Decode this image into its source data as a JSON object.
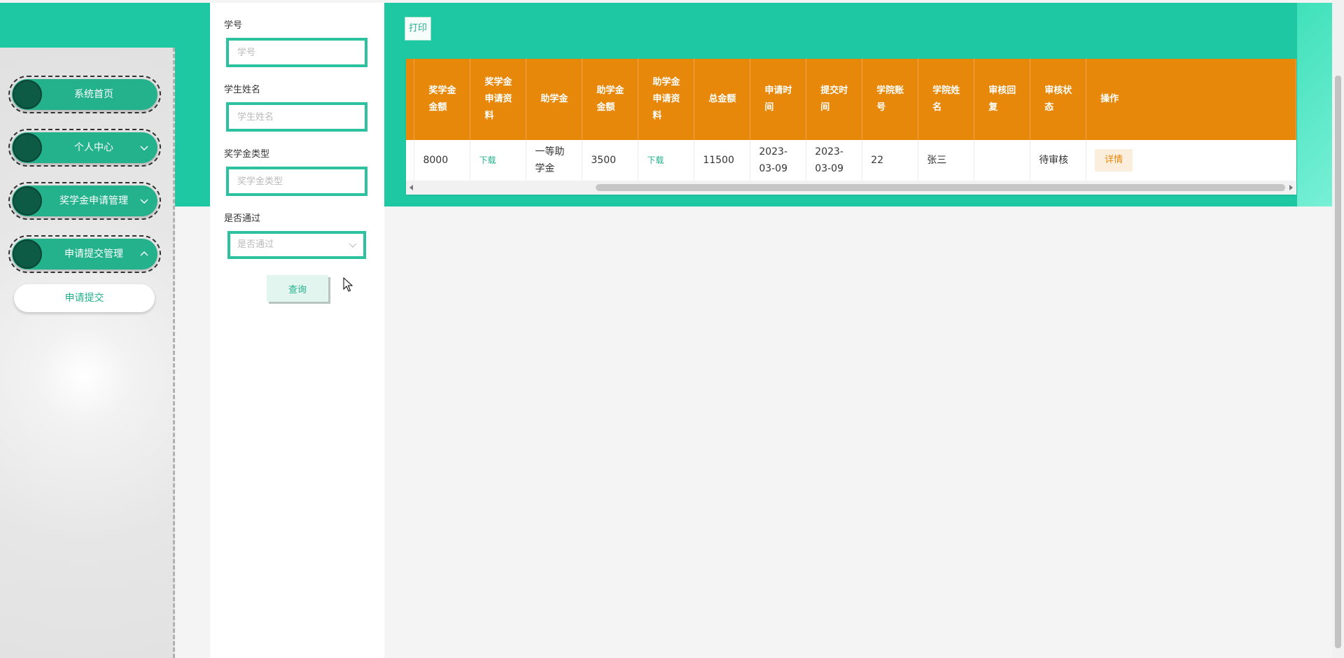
{
  "sidebar": {
    "items": [
      {
        "label": "系统首页",
        "chevron": "none"
      },
      {
        "label": "个人中心",
        "chevron": "down"
      },
      {
        "label": "奖学金申请管理",
        "chevron": "down"
      },
      {
        "label": "申请提交管理",
        "chevron": "up"
      }
    ],
    "submenu": {
      "label": "申请提交"
    }
  },
  "search": {
    "student_no": {
      "label": "学号",
      "placeholder": "学号",
      "value": ""
    },
    "student_name": {
      "label": "学生姓名",
      "placeholder": "学生姓名",
      "value": ""
    },
    "scholarship_type": {
      "label": "奖学金类型",
      "placeholder": "奖学金类型",
      "value": ""
    },
    "passed": {
      "label": "是否通过",
      "placeholder": "是否通过"
    },
    "query_label": "查询"
  },
  "toolbar": {
    "print_label": "打印"
  },
  "table": {
    "headers": [
      "奖学金金额",
      "奖学金申请资料",
      "助学金",
      "助学金金额",
      "助学金申请资料",
      "总金额",
      "申请时间",
      "提交时间",
      "学院账号",
      "学院姓名",
      "审核回复",
      "审核状态",
      "操作"
    ],
    "rows": [
      {
        "scholarship_amount": "8000",
        "scholarship_file": "下载",
        "grant": "一等助学金",
        "grant_amount": "3500",
        "grant_file": "下载",
        "total": "11500",
        "apply_time": "2023-03-09",
        "submit_time": "2023-03-09",
        "account": "22",
        "name": "张三",
        "reply": "",
        "status": "待审核",
        "action": "详情"
      }
    ]
  },
  "colors": {
    "accent": "#1ec8a2",
    "menu_green": "#23b28c",
    "header_orange": "#e8880a"
  }
}
